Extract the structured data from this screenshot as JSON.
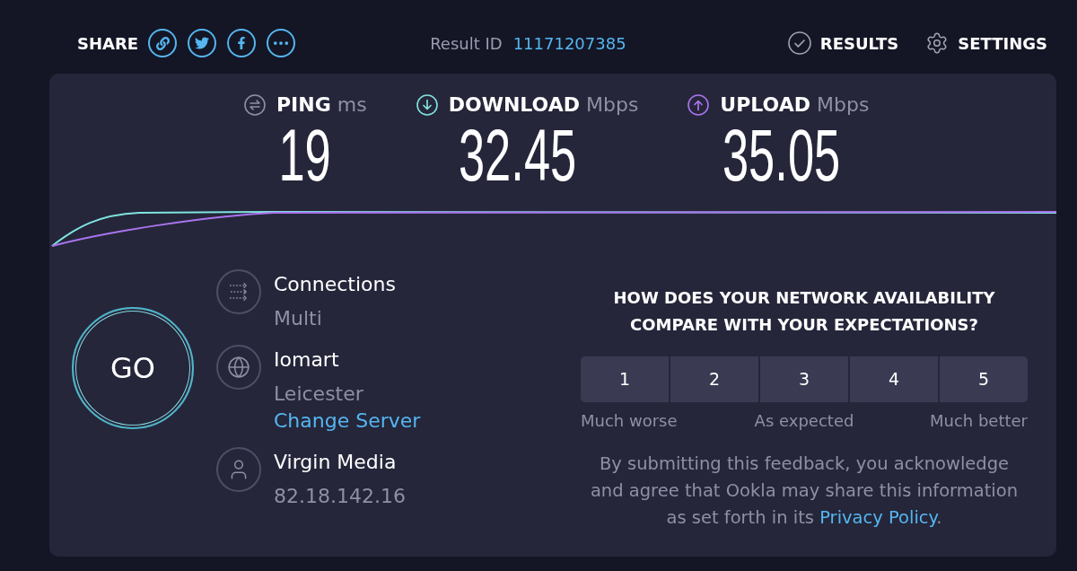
{
  "header": {
    "share_label": "SHARE",
    "share_buttons": [
      {
        "kind": "link"
      },
      {
        "kind": "twitter"
      },
      {
        "kind": "facebook"
      },
      {
        "kind": "more"
      }
    ],
    "result_id": {
      "label": "Result ID",
      "value": "11171207385"
    },
    "nav": [
      {
        "kind": "results",
        "label": "RESULTS"
      },
      {
        "kind": "settings",
        "label": "SETTINGS"
      }
    ]
  },
  "metrics": [
    {
      "kind": "ping",
      "label": "PING",
      "unit": "ms",
      "value": "19",
      "color": "#8e90a5"
    },
    {
      "kind": "download",
      "label": "DOWNLOAD",
      "unit": "Mbps",
      "value": "32.45",
      "color": "#7fe3df"
    },
    {
      "kind": "upload",
      "label": "UPLOAD",
      "unit": "Mbps",
      "value": "35.05",
      "color": "#aa74ee"
    }
  ],
  "go_button": {
    "label": "GO"
  },
  "server_info": [
    {
      "kind": "connections",
      "title": "Connections",
      "subtitle": "Multi"
    },
    {
      "kind": "server",
      "title": "Iomart",
      "subtitle": "Leicester",
      "link": "Change Server"
    },
    {
      "kind": "provider",
      "title": "Virgin Media",
      "subtitle": "82.18.142.16"
    }
  ],
  "feedback": {
    "question": "HOW DOES YOUR NETWORK AVAILABILITY COMPARE WITH YOUR EXPECTATIONS?",
    "ratings": [
      {
        "label": "1",
        "selected": false
      },
      {
        "label": "2",
        "selected": false
      },
      {
        "label": "3",
        "selected": false
      },
      {
        "label": "4",
        "selected": false
      },
      {
        "label": "5",
        "selected": false
      }
    ],
    "scale_labels": [
      "Much worse",
      "As expected",
      "Much better"
    ],
    "disclaimer": {
      "text": "By submitting this feedback, you acknowledge and agree that Ookla may share this information as set forth in its",
      "link": "Privacy Policy",
      "end": "."
    }
  }
}
